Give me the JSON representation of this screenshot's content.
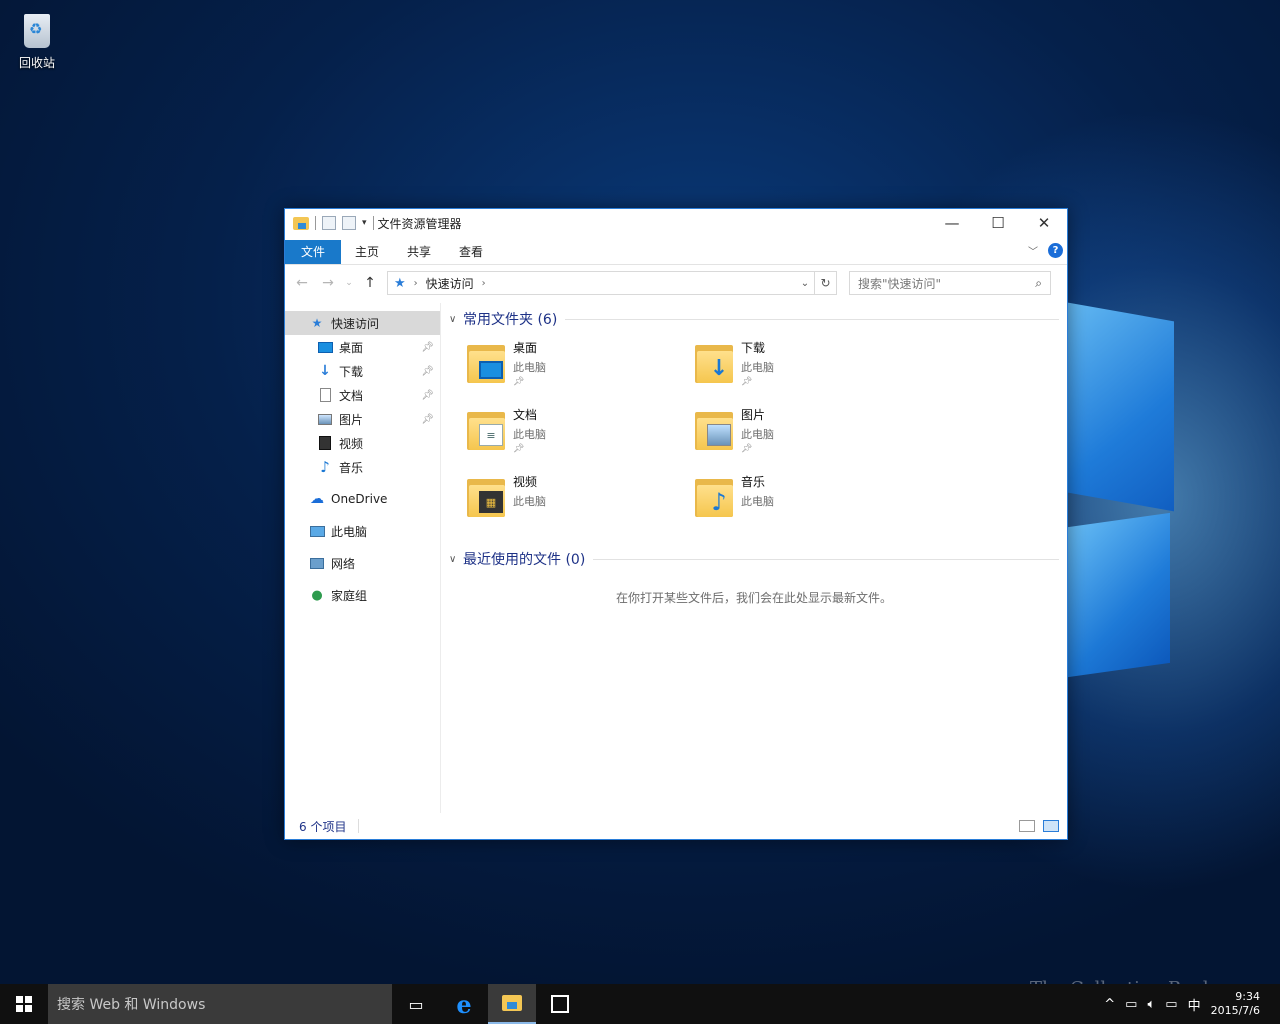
{
  "desktop": {
    "recycle_bin_label": "回收站"
  },
  "window": {
    "title": "文件资源管理器",
    "controls": {
      "minimize": "—",
      "maximize": "☐",
      "close": "✕"
    },
    "ribbon_tabs": [
      "文件",
      "主页",
      "共享",
      "查看"
    ],
    "help": "?",
    "address": {
      "root_icon": "quick-access-star-icon",
      "path": "快速访问"
    },
    "search_placeholder": "搜索\"快速访问\""
  },
  "navpane": {
    "quick_access": "快速访问",
    "pinned": [
      {
        "label": "桌面",
        "icon": "desktop-icon",
        "pinned": true
      },
      {
        "label": "下载",
        "icon": "download-icon",
        "pinned": true
      },
      {
        "label": "文档",
        "icon": "document-icon",
        "pinned": true
      },
      {
        "label": "图片",
        "icon": "picture-icon",
        "pinned": true
      },
      {
        "label": "视频",
        "icon": "video-icon",
        "pinned": false
      },
      {
        "label": "音乐",
        "icon": "music-icon",
        "pinned": false
      }
    ],
    "onedrive": "OneDrive",
    "this_pc": "此电脑",
    "network": "网络",
    "homegroup": "家庭组"
  },
  "content": {
    "frequent_header": "常用文件夹 (6)",
    "folders": [
      {
        "name": "桌面",
        "location": "此电脑",
        "pinned": true
      },
      {
        "name": "下载",
        "location": "此电脑",
        "pinned": true
      },
      {
        "name": "文档",
        "location": "此电脑",
        "pinned": true
      },
      {
        "name": "图片",
        "location": "此电脑",
        "pinned": true
      },
      {
        "name": "视频",
        "location": "此电脑",
        "pinned": false
      },
      {
        "name": "音乐",
        "location": "此电脑",
        "pinned": false
      }
    ],
    "recent_header": "最近使用的文件 (0)",
    "recent_empty": "在你打开某些文件后，我们会在此处显示最新文件。"
  },
  "statusbar": {
    "count": "6 个项目"
  },
  "taskbar": {
    "search_placeholder": "搜索 Web 和 Windows",
    "ime": "中",
    "time": "9:34",
    "date": "2015/7/6"
  },
  "watermark": "The Collection Book",
  "colors": {
    "accent": "#1979ca",
    "group_header": "#1e3287",
    "folder": "#f5c64e"
  }
}
